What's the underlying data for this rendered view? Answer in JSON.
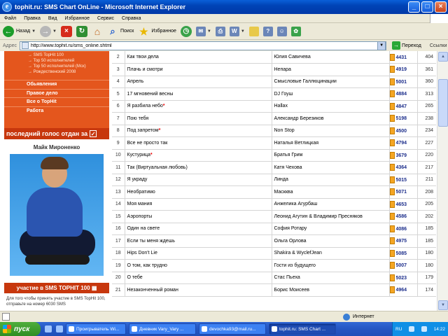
{
  "window": {
    "title": "tophit.ru: SMS Chart OnLine - Microsoft Internet Explorer"
  },
  "menu": [
    "Файл",
    "Правка",
    "Вид",
    "Избранное",
    "Сервис",
    "Справка"
  ],
  "toolbar": {
    "back": "Назад",
    "search": "Поиск",
    "favorites": "Избранное"
  },
  "address": {
    "label": "Адрес",
    "url": "http://www.tophit.ru/sms_online.shtml",
    "go": "Переход",
    "links": "Ссылки"
  },
  "sidebar": {
    "small_links": [
      "SMS TopHit 100",
      "Top 50 исполнителей",
      "Top 50 исполнителей (Мск)",
      "Рождественский 2008"
    ],
    "nav": [
      "Обьявления",
      "Правое дело",
      "Все о TopHit",
      "Работа"
    ],
    "vote_banner": "последний голос отдан за",
    "artist": "Майк Мироненко",
    "participate": "участие в SMS TOPHIT 100",
    "note": "Для того чтобы принять участие в SMS TopHit 100, отправьте на номер 6030 SMS"
  },
  "rows": [
    {
      "n": "2",
      "song": "Как твои дела",
      "artist": "Юлия Савичева",
      "code": "4431",
      "votes": "404",
      "mark": false
    },
    {
      "n": "3",
      "song": "Плачь и смотри",
      "artist": "Непара",
      "code": "4919",
      "votes": "361",
      "mark": false
    },
    {
      "n": "4",
      "song": "Апрель",
      "artist": "Смысловые Галлюцинации",
      "code": "5001",
      "votes": "360",
      "mark": false
    },
    {
      "n": "5",
      "song": "17 мгновений весны",
      "artist": "DJ Гоуш",
      "code": "4884",
      "votes": "313",
      "mark": false
    },
    {
      "n": "6",
      "song": "Я разбила небо",
      "artist": "Hallax",
      "code": "4847",
      "votes": "265",
      "mark": true
    },
    {
      "n": "7",
      "song": "Пою тебя",
      "artist": "Александр Березиков",
      "code": "5198",
      "votes": "238",
      "mark": false
    },
    {
      "n": "8",
      "song": "Под запретом",
      "artist": "Non Stop",
      "code": "4500",
      "votes": "234",
      "mark": true
    },
    {
      "n": "9",
      "song": "Все не просто так",
      "artist": "Наталья Ветлицкая",
      "code": "4794",
      "votes": "227",
      "mark": false
    },
    {
      "n": "10",
      "song": "Кустурица",
      "artist": "Братья Грим",
      "code": "3679",
      "votes": "220",
      "mark": true
    },
    {
      "n": "11",
      "song": "Так (Виртуальная любовь)",
      "artist": "Катя Чехова",
      "code": "4364",
      "votes": "217",
      "mark": false
    },
    {
      "n": "12",
      "song": "Я украду",
      "artist": "Линда",
      "code": "5015",
      "votes": "211",
      "mark": false
    },
    {
      "n": "13",
      "song": "Необратимо",
      "artist": "Маскква",
      "code": "5071",
      "votes": "208",
      "mark": false
    },
    {
      "n": "14",
      "song": "Моя мания",
      "artist": "Анжелика Агурбаш",
      "code": "4653",
      "votes": "205",
      "mark": false
    },
    {
      "n": "15",
      "song": "Аэропорты",
      "artist": "Леонид Агутин & Владимир Пресняков",
      "code": "4586",
      "votes": "202",
      "mark": false
    },
    {
      "n": "16",
      "song": "Один на свете",
      "artist": "София Ротару",
      "code": "4086",
      "votes": "185",
      "mark": false
    },
    {
      "n": "17",
      "song": "Если ты меня ждешь",
      "artist": "Ольга Орлова",
      "code": "4975",
      "votes": "185",
      "mark": false
    },
    {
      "n": "18",
      "song": "Hips Don't Lie",
      "artist": "Shakira & WyclefJean",
      "code": "5085",
      "votes": "180",
      "mark": false
    },
    {
      "n": "19",
      "song": "О том, как трудно",
      "artist": "Гости из будущего",
      "code": "5007",
      "votes": "180",
      "mark": false
    },
    {
      "n": "20",
      "song": "О тебе",
      "artist": "Стас Пьеха",
      "code": "5023",
      "votes": "179",
      "mark": false
    },
    {
      "n": "21",
      "song": "Незаконченный роман",
      "artist": "Борис Моисеев",
      "code": "4964",
      "votes": "174",
      "mark": false
    }
  ],
  "status": {
    "zone": "Интернет"
  },
  "taskbar": {
    "start": "пуск",
    "tasks": [
      "Проигрыватель Wi...",
      "Дневник Vary_Vary ...",
      "devochka93@mail.ru...",
      "tophit.ru: SMS Chart ..."
    ],
    "lang": "RU",
    "time": "14:22"
  }
}
